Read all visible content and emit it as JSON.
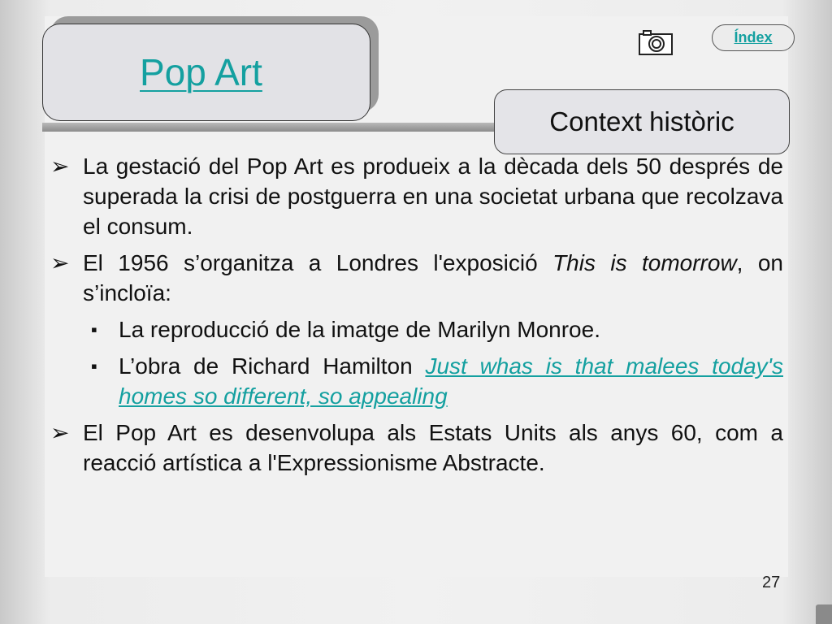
{
  "title": "Pop Art",
  "section_title": "Context històric",
  "nav": {
    "index_label": "Índex"
  },
  "icons": {
    "camera": "camera-icon"
  },
  "page_number": "27",
  "bullets": [
    {
      "text": "La gestació del Pop Art es produeix a la dècada dels 50 després de superada la crisi de postguerra en una societat urbana que recolzava el consum."
    },
    {
      "pre": "El 1956 s’organitza a Londres l'exposició ",
      "italic": "This is tomorrow",
      "post": ", on s’incloïa:"
    },
    {
      "text": "El Pop Art es desenvolupa als Estats Units als anys 60, com a reacció artística a l'Expressionisme Abstracte."
    }
  ],
  "sub_bullets": [
    {
      "text": " La reproducció de la imatge de Marilyn Monroe."
    },
    {
      "pre": "L’obra de Richard Hamilton ",
      "link": "Just whas is that malees today's homes so different, so appealing"
    }
  ],
  "markers": {
    "bullet": "➢",
    "sub_bullet": "▪"
  },
  "colors": {
    "link": "#14a0a0",
    "title_box": "#e2e2e6",
    "bar": "#9b9b9b"
  }
}
